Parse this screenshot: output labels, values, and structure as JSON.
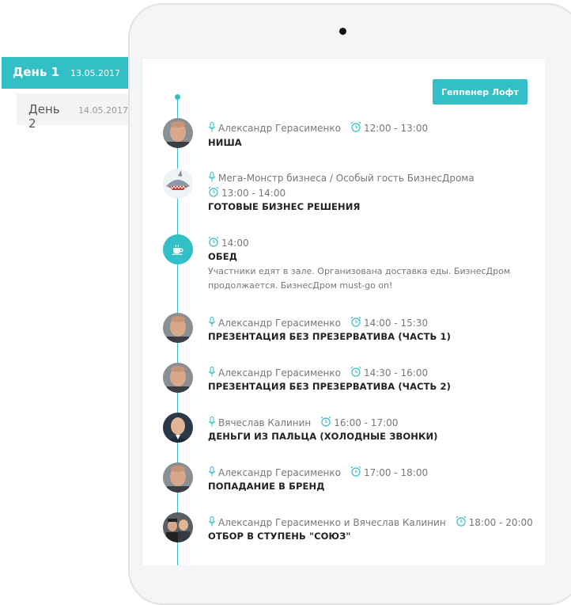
{
  "days": [
    {
      "label": "День 1",
      "date": "13.05.2017"
    },
    {
      "label": "День 2",
      "date": "14.05.2017"
    }
  ],
  "venue_button": "Геппенер Лофт",
  "colors": {
    "accent": "#33bfc6"
  },
  "events": [
    {
      "speaker": "Александр Герасименко",
      "time": "12:00 - 13:00",
      "title": "НИША",
      "avatar": "man-bald"
    },
    {
      "speaker": "Мега-Монстр бизнеса / Особый гость БизнесДрома",
      "time": "13:00 - 14:00",
      "title": "ГОТОВЫЕ БИЗНЕС РЕШЕНИЯ",
      "avatar": "shark"
    },
    {
      "time": "14:00",
      "title": "ОБЕД",
      "description": "Участники едят в зале. Организована доставка еды. БизнесДром продолжается. БизнесДром must-go on!",
      "icon": "coffee-cup-icon"
    },
    {
      "speaker": "Александр Герасименко",
      "time": "14:00 - 15:30",
      "title": "ПРЕЗЕНТАЦИЯ БЕЗ ПРЕЗЕРВАТИВА (ЧАСТЬ 1)",
      "avatar": "man-bald"
    },
    {
      "speaker": "Александр Герасименко",
      "time": "14:30 - 16:00",
      "title": "ПРЕЗЕНТАЦИЯ БЕЗ ПРЕЗЕРВАТИВА (ЧАСТЬ 2)",
      "avatar": "man-bald"
    },
    {
      "speaker": "Вячеслав Калинин",
      "time": "16:00 - 17:00",
      "title": "ДЕНЬГИ ИЗ ПАЛЬЦА (ХОЛОДНЫЕ ЗВОНКИ)",
      "avatar": "man-suit"
    },
    {
      "speaker": "Александр Герасименко",
      "time": "17:00 - 18:00",
      "title": "ПОПАДАНИЕ В БРЕНД",
      "avatar": "man-bald"
    },
    {
      "speaker": "Александр Герасименко и Вячеслав Калинин",
      "time": "18:00 - 20:00",
      "title": "ОТБОР В СТУПЕНЬ \"СОЮЗ\"",
      "avatar": "group"
    }
  ]
}
